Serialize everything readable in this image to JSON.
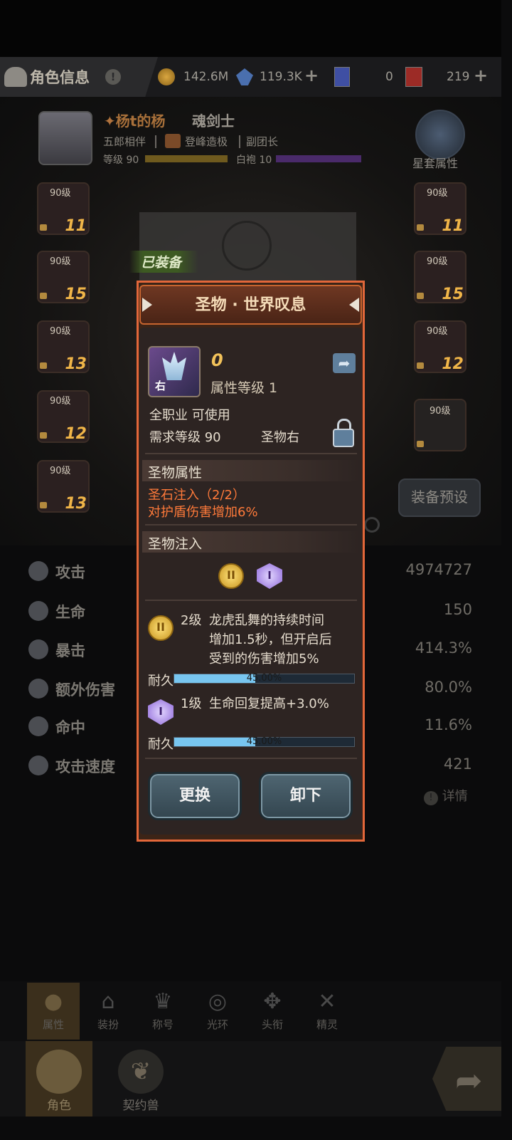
{
  "topbar": {
    "title": "角色信息",
    "gold": "142.6M",
    "crystal": "119.3K",
    "tickets": "0",
    "card": "219"
  },
  "character": {
    "name": "杨t的杨",
    "class": "魂剑士",
    "partner": "五郎相伴",
    "guild": "登峰造极",
    "role": "副团长",
    "level_label": "等级 90",
    "rank_label": "白袍 10",
    "star_set_label": "星套属性",
    "equipped_tag": "已装备",
    "preset_button": "装备预设"
  },
  "equip_slots_left": [
    {
      "level": "90级",
      "enhance": "11"
    },
    {
      "level": "90级",
      "enhance": "15"
    },
    {
      "level": "90级",
      "enhance": "13"
    },
    {
      "level": "90级",
      "enhance": "12"
    },
    {
      "level": "90级",
      "enhance": "13"
    }
  ],
  "equip_slots_right": [
    {
      "level": "90级",
      "enhance": "11"
    },
    {
      "level": "90级",
      "enhance": "15"
    },
    {
      "level": "90级",
      "enhance": "12"
    },
    {
      "level": "90级",
      "enhance": ""
    }
  ],
  "stats": [
    {
      "label": "攻击",
      "value": "4974727"
    },
    {
      "label": "生命",
      "value": "150"
    },
    {
      "label": "暴击",
      "value": "414.3%"
    },
    {
      "label": "额外伤害",
      "value": "80.0%"
    },
    {
      "label": "命中",
      "value": "11.6%"
    },
    {
      "label": "攻击速度",
      "value": "421"
    }
  ],
  "details_link": "详情",
  "dialog": {
    "title": "圣物 · 世界叹息",
    "score": "0",
    "attr_level": "属性等级 1",
    "icon_tag": "右",
    "usable": "全职业 可使用",
    "req_level": "需求等级 90",
    "slot": "圣物右",
    "section_attr": "圣物属性",
    "stone_infuse": "圣石注入（2/2）",
    "shield_bonus": "对护盾伤害增加6%",
    "section_infuse": "圣物注入",
    "medal_numeral": "II",
    "gem_numeral": "I",
    "effect1_level": "2级",
    "effect1_text_1": "龙虎乱舞的持续时间",
    "effect1_text_2": "增加1.5秒，但开启后",
    "effect1_text_3": "受到的伤害增加5%",
    "durability_label": "耐久",
    "durability1": "45.00%",
    "durability1_value": 45,
    "effect2_level": "1级",
    "effect2_text": "生命回复提高+3.0%",
    "durability2": "45.00%",
    "durability2_value": 45,
    "replace_button": "更换",
    "unequip_button": "卸下"
  },
  "subnav": [
    "属性",
    "装扮",
    "称号",
    "光环",
    "头衔",
    "精灵"
  ],
  "bottomnav": [
    "角色",
    "契约兽"
  ],
  "colors": {
    "dialog_border": "#e2673a",
    "accent_orange": "#ff7a3a",
    "durability_bar": "#78c6f0",
    "gold_text": "#f0b548"
  }
}
